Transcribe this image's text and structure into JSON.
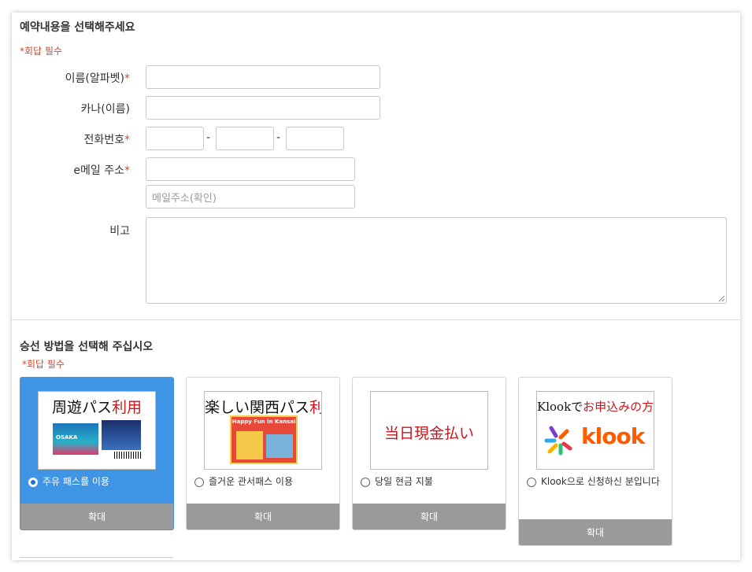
{
  "section1": {
    "title": "예약내용을 선택해주세요",
    "required_note": "*회답 필수",
    "fields": {
      "name_label": "이름(알파벳)",
      "kana_label": "카나(이름)",
      "phone_label": "전화번호",
      "phone_dash": "-",
      "email_label": "e메일 주소",
      "email_confirm_placeholder": "메일주소(확인)",
      "notes_label": "비고",
      "star": "*"
    }
  },
  "section2": {
    "title": "승선 방법을 선택해 주십시오",
    "required_note": "*회답 필수",
    "options": [
      {
        "img_title_black": "周遊パス",
        "img_title_red": "利用",
        "img_subtitle": "OSAKA",
        "label": "주유 패스를 이용",
        "zoom": "확대",
        "selected": true
      },
      {
        "img_title_black": "楽しい関西パス",
        "img_title_red": "利用",
        "img_subtitle": "Happy Fun in Kansai",
        "label": "즐거운 관서패스 이용",
        "zoom": "확대",
        "selected": false
      },
      {
        "img_title_red": "当日現金払い",
        "label": "당일 현금 지불",
        "zoom": "확대",
        "selected": false
      },
      {
        "img_title_black": "Klookで",
        "img_title_red": "お申込みの方",
        "img_brand": "klook",
        "label": "Klook으로 신청하신 분입니다",
        "zoom": "확대",
        "selected": false
      }
    ]
  },
  "colors": {
    "required": "#d9472b",
    "selected_card": "#3f95e4",
    "zoom_bar": "#9a9a9a",
    "klook_orange": "#ff5b00",
    "jp_red": "#c8161d"
  }
}
